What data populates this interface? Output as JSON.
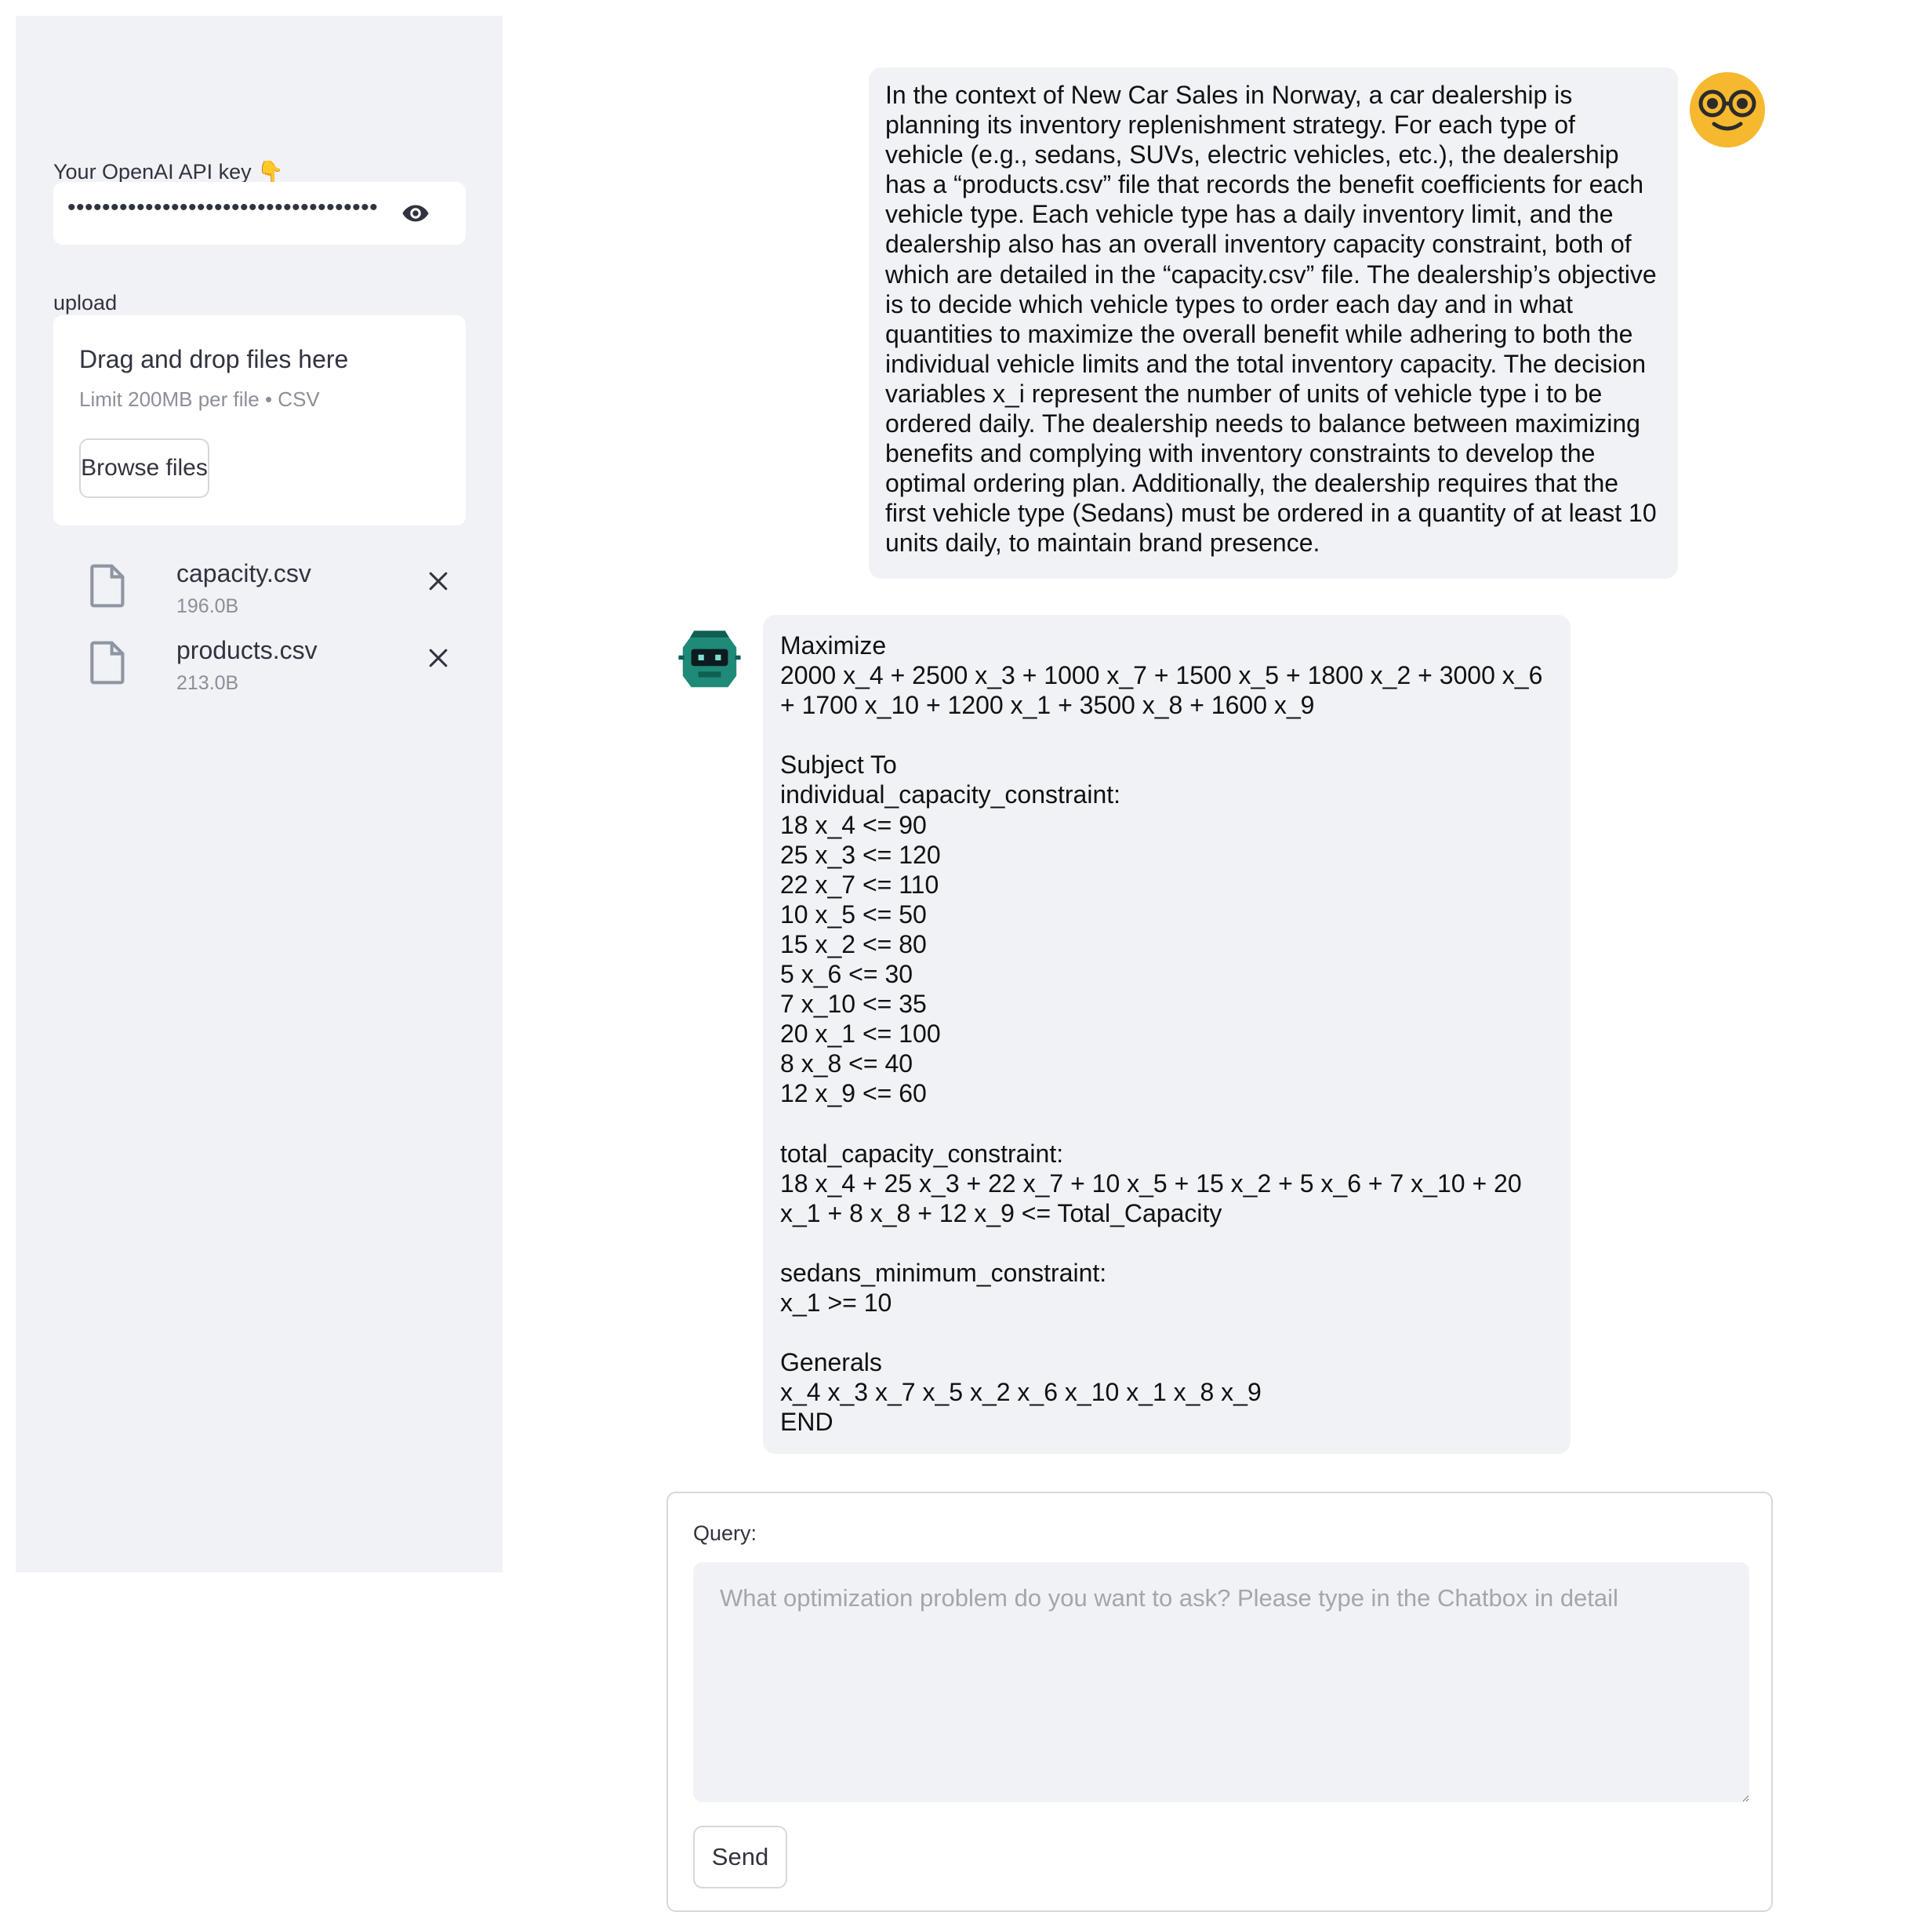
{
  "sidebar": {
    "api_key_label": "Your OpenAI API key 👇",
    "api_key_value": "•••••••••••••••••••••••••••••••••••••••••",
    "upload_label": "upload",
    "dropzone": {
      "title": "Drag and drop files here",
      "limit": "Limit 200MB per file • CSV",
      "browse_label": "Browse files"
    },
    "files": [
      {
        "name": "capacity.csv",
        "size": "196.0B"
      },
      {
        "name": "products.csv",
        "size": "213.0B"
      }
    ]
  },
  "chat": {
    "user_message": "In the context of New Car Sales in Norway, a car dealership is\nplanning its inventory replenishment strategy. For each type of\nvehicle (e.g., sedans, SUVs, electric vehicles, etc.), the dealership\nhas a “products.csv” file that records the benefit coefficients for each\nvehicle type. Each vehicle type has a daily inventory limit, and the\ndealership also has an overall inventory capacity constraint, both of\nwhich are detailed in the “capacity.csv” file. The dealership’s objective\nis to decide which vehicle types to order each day and in what\nquantities to maximize the overall benefit while adhering to both the\nindividual vehicle limits and the total inventory capacity. The decision\nvariables x_i represent the number of units of vehicle type i to be\nordered daily. The dealership needs to balance between maximizing\nbenefits and complying with inventory constraints to develop the\noptimal ordering plan. Additionally, the dealership requires that the\nfirst vehicle type (Sedans) must be ordered in a quantity of at least 10\nunits daily, to maintain brand presence.",
    "assistant_message": "Maximize\n2000 x_4 + 2500 x_3 + 1000 x_7 + 1500 x_5 + 1800 x_2 + 3000 x_6\n+ 1700 x_10 + 1200 x_1 + 3500 x_8 + 1600 x_9\n\nSubject To\nindividual_capacity_constraint:\n18 x_4 <= 90\n25 x_3 <= 120\n22 x_7 <= 110\n10 x_5 <= 50\n15 x_2 <= 80\n5 x_6 <= 30\n7 x_10 <= 35\n20 x_1 <= 100\n8 x_8 <= 40\n12 x_9 <= 60\n\ntotal_capacity_constraint:\n18 x_4 + 25 x_3 + 22 x_7 + 10 x_5 + 15 x_2 + 5 x_6 + 7 x_10 + 20\nx_1 + 8 x_8 + 12 x_9 <= Total_Capacity\n\nsedans_minimum_constraint:\nx_1 >= 10\n\nGenerals\nx_4 x_3 x_7 x_5 x_2 x_6 x_10 x_1 x_8 x_9\nEND"
  },
  "query": {
    "label": "Query:",
    "placeholder": "What optimization problem do you want to ask? Please type in the Chatbox in detail",
    "value": "",
    "send_label": "Send"
  },
  "colors": {
    "sidebar_bg": "#f0f2f6",
    "bubble_bg": "#f0f2f6",
    "user_avatar": "#f5b82e",
    "bot_avatar": "#1f8a78"
  },
  "icons": [
    "eye-icon",
    "file-icon",
    "close-icon",
    "user-avatar-icon",
    "bot-avatar-icon",
    "resize-handle-icon"
  ]
}
